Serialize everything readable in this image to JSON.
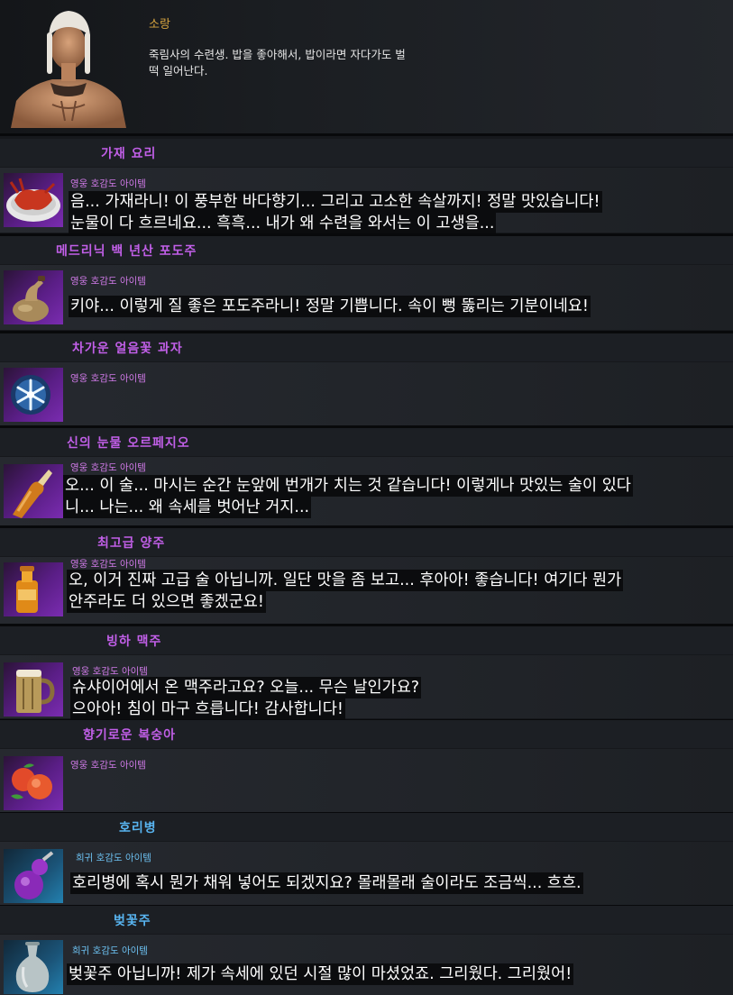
{
  "npc": {
    "name": "소랑",
    "description": "죽림사의 수련생. 밥을 좋아해서, 밥이라면 자다가도 벌떡 일어난다."
  },
  "items": [
    {
      "name": "가재 요리",
      "grade": "영웅 호감도 아이템",
      "rarity": "hero",
      "icon": "crayfish-dish-icon",
      "lines": [
        "음... 가재라니! 이 풍부한 바다향기... 그리고 고소한 속살까지! 정말 맛있습니다!",
        "눈물이 다 흐르네요... 흑흑... 내가 왜 수련을 와서는 이 고생을..."
      ]
    },
    {
      "name": "메드리닉 백 년산 포도주",
      "grade": "영웅 호감도 아이템",
      "rarity": "hero",
      "icon": "wine-gourd-icon",
      "lines": [
        "키야... 이렇게 질 좋은 포도주라니! 정말 기쁩니다. 속이 뻥 뚫리는 기분이네요!"
      ]
    },
    {
      "name": "차가운 얼음꽃 과자",
      "grade": "영웅 호감도 아이템",
      "rarity": "hero",
      "icon": "ice-flower-icon",
      "lines": []
    },
    {
      "name": "신의 눈물 오르페지오",
      "grade": "영웅 호감도 아이템",
      "rarity": "hero",
      "icon": "liquor-bottle-icon",
      "lines": [
        "오... 이 술... 마시는 순간 눈앞에 번개가 치는 것 같습니다! 이렇게나 맛있는 술이 있다",
        "니... 나는... 왜 속세를 벗어난 거지..."
      ]
    },
    {
      "name": "최고급 양주",
      "grade": "영웅 호감도 아이템",
      "rarity": "hero",
      "icon": "whiskey-bottle-icon",
      "lines": [
        "오, 이거 진짜 고급 술 아닙니까. 일단 맛을 좀 보고... 후아아! 좋습니다! 여기다 뭔가",
        "안주라도 더 있으면 좋겠군요!"
      ]
    },
    {
      "name": "빙하 맥주",
      "grade": "영웅 호감도 아이템",
      "rarity": "hero",
      "icon": "beer-mug-icon",
      "lines": [
        "슈샤이어에서 온 맥주라고요? 오늘... 무슨 날인가요?",
        "으아아! 침이 마구 흐릅니다! 감사합니다!"
      ]
    },
    {
      "name": "향기로운 복숭아",
      "grade": "영웅 호감도 아이템",
      "rarity": "hero",
      "icon": "peach-icon",
      "lines": []
    },
    {
      "name": "호리병",
      "grade": "희귀 호감도 아이템",
      "rarity": "rare",
      "icon": "gourd-bottle-icon",
      "lines": [
        "호리병에 혹시 뭔가 채워 넣어도 되겠지요? 몰래몰래 술이라도 조금씩... 흐흐."
      ]
    },
    {
      "name": "벚꽃주",
      "grade": "희귀 호감도 아이템",
      "rarity": "rare",
      "icon": "vase-bottle-icon",
      "lines": [
        "벚꽃주 아닙니까! 제가 속세에 있던 시절 많이 마셨었죠. 그리웠다. 그리웠어!"
      ]
    }
  ]
}
